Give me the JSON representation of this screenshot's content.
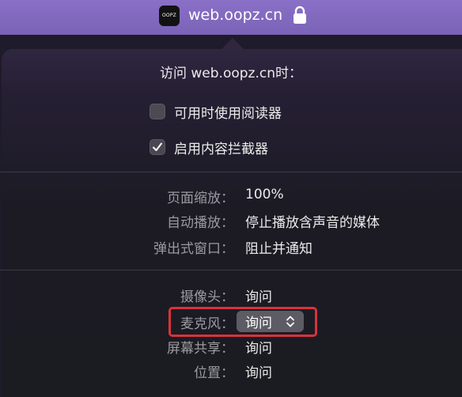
{
  "topbar": {
    "logo_text": "OOPZ",
    "url": "web.oopz.cn",
    "lock_icon": "lock-icon"
  },
  "panel": {
    "header": "访问 web.oopz.cn时：",
    "checks": [
      {
        "label": "可用时使用阅读器",
        "checked": false
      },
      {
        "label": "启用内容拦截器",
        "checked": true
      }
    ],
    "settings": [
      {
        "label": "页面缩放：",
        "value": "100%"
      },
      {
        "label": "自动播放：",
        "value": "停止播放含声音的媒体"
      },
      {
        "label": "弹出式窗口：",
        "value": "阻止并通知"
      }
    ],
    "permissions": [
      {
        "label": "摄像头：",
        "value": "询问"
      },
      {
        "label": "麦克风：",
        "value": "询问"
      },
      {
        "label": "屏幕共享：",
        "value": "询问"
      },
      {
        "label": "位置：",
        "value": "询问"
      }
    ]
  },
  "colors": {
    "topbar": "#7a63b7",
    "highlight": "#d8333b"
  }
}
